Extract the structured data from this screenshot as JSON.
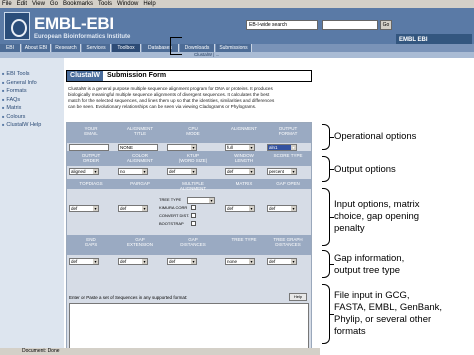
{
  "browser": {
    "menu": [
      "File",
      "Edit",
      "View",
      "Go",
      "Bookmarks",
      "Tools",
      "Window",
      "Help"
    ],
    "status": "Document: Done"
  },
  "header": {
    "logo_text": "EMBL-EBI",
    "logo_subtitle": "European Bioinformatics Institute",
    "search_scope": "EB-I-wide search",
    "go_label": "Go",
    "right_logo_text": "EMBL  EBI"
  },
  "nav": {
    "tabs": [
      "EBI Home",
      "About EBI",
      "Research",
      "Services",
      "Toolbox",
      "Databases",
      "Downloads",
      "Submissions"
    ],
    "subtabs": "ClustalW  |  ..."
  },
  "sidebar": {
    "items": [
      "EBI Tools",
      "General Info",
      "Formats",
      "FAQs",
      "Matrix",
      "Colours",
      "ClustalW Help"
    ]
  },
  "form_title": {
    "tag": "ClustalW",
    "text": "Submission Form"
  },
  "intro_lines": [
    "ClustalW is a general purpose multiple sequence alignment program for DNA or proteins. It produces",
    "biologically meaningful multiple sequence alignments of divergent sequences. It calculates the best",
    "match for the selected sequences, and lines them up so that the identities, similarities and differences",
    "can be seen. Evolutionary relationships can be seen via viewing Cladograms or Phylograms."
  ],
  "rows": {
    "row1_labels": [
      "YOUR\nEMAIL",
      "ALIGNMENT\nTITLE",
      "CPU\nMODE",
      "ALIGNMENT",
      "OUTPUT\nFORMAT"
    ],
    "row1_values": [
      "",
      "NONE",
      "",
      "full",
      "aln1"
    ],
    "row2_labels": [
      "OUTPUT\nORDER",
      "COLOR\nALIGNMENT",
      "KTUP\n(WORD SIZE)",
      "WINDOW\nLENGTH",
      "SCORE TYPE"
    ],
    "row2_values": [
      "aligned",
      "no",
      "def",
      "def",
      "percent"
    ],
    "row3_labels": [
      "TOPDIAGS",
      "PAIRGAP",
      "MULTIPLE\nALIGNMENT",
      "MATRIX",
      "GAP OPEN"
    ],
    "row3_values": [
      "def",
      "def",
      "",
      "def",
      "def"
    ],
    "multi_options": [
      "TREE TYPE",
      "KIMURA CORR",
      "CONVERT DIST.",
      "BOOTSTRAP"
    ],
    "row4_labels": [
      "END\nGAPS",
      "GAP\nEXTENSION",
      "GAP\nDISTANCES",
      "TREE TYPE",
      "TREE GRAPH\nDISTANCES"
    ],
    "row4_values": [
      "def",
      "def",
      "def",
      "none",
      "def"
    ],
    "upload_label": "Enter or Paste a set of Sequences in any supported format:",
    "help_label": "Help"
  },
  "annotations": [
    "Operational options",
    "Output options",
    "Input options, matrix\nchoice, gap opening\npenalty",
    "Gap information,\noutput tree type",
    "File input in GCG,\nFASTA, EMBL, GenBank,\nPhylip, or several other\nformats"
  ],
  "colors": {
    "header_blue": "#5a7aa6",
    "form_band": "#9aaac2",
    "selected_dropdown": "#3352a0"
  }
}
